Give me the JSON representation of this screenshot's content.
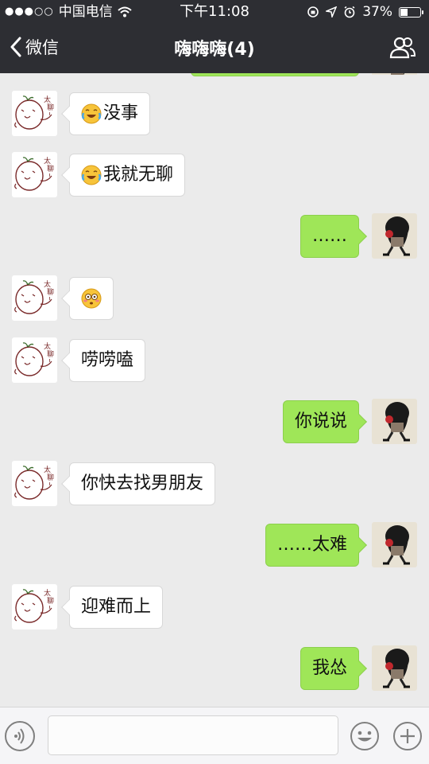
{
  "status_bar": {
    "signal": "●●●○○",
    "carrier": "中国电信",
    "time": "下午11:08",
    "battery_percent": "37%",
    "battery_level": 0.37
  },
  "nav": {
    "back_label": "微信",
    "title": "嗨嗨嗨(4)"
  },
  "colors": {
    "header_bg": "#2d2e33",
    "chat_bg": "#ebebeb",
    "sent_bubble": "#9fe658",
    "received_bubble": "#ffffff"
  },
  "messages": [
    {
      "side": "left",
      "emoji": "crying-laughing-emoji",
      "text": "没事"
    },
    {
      "side": "left",
      "emoji": "crying-laughing-emoji",
      "text": "我就无聊"
    },
    {
      "side": "right",
      "emoji": "",
      "text": "……"
    },
    {
      "side": "left",
      "emoji": "flushed-emoji",
      "text": ""
    },
    {
      "side": "left",
      "emoji": "",
      "text": "唠唠嗑"
    },
    {
      "side": "right",
      "emoji": "",
      "text": "你说说"
    },
    {
      "side": "left",
      "emoji": "",
      "text": "你快去找男朋友"
    },
    {
      "side": "right",
      "emoji": "",
      "text": "……太难"
    },
    {
      "side": "left",
      "emoji": "",
      "text": "迎难而上"
    },
    {
      "side": "right",
      "emoji": "",
      "text": "我怂"
    }
  ],
  "input": {
    "placeholder": "",
    "value": ""
  },
  "icons": {
    "back": "chevron-left-icon",
    "members": "people-icon",
    "voice": "voice-icon",
    "emoji": "smiley-icon",
    "more": "plus-icon"
  }
}
